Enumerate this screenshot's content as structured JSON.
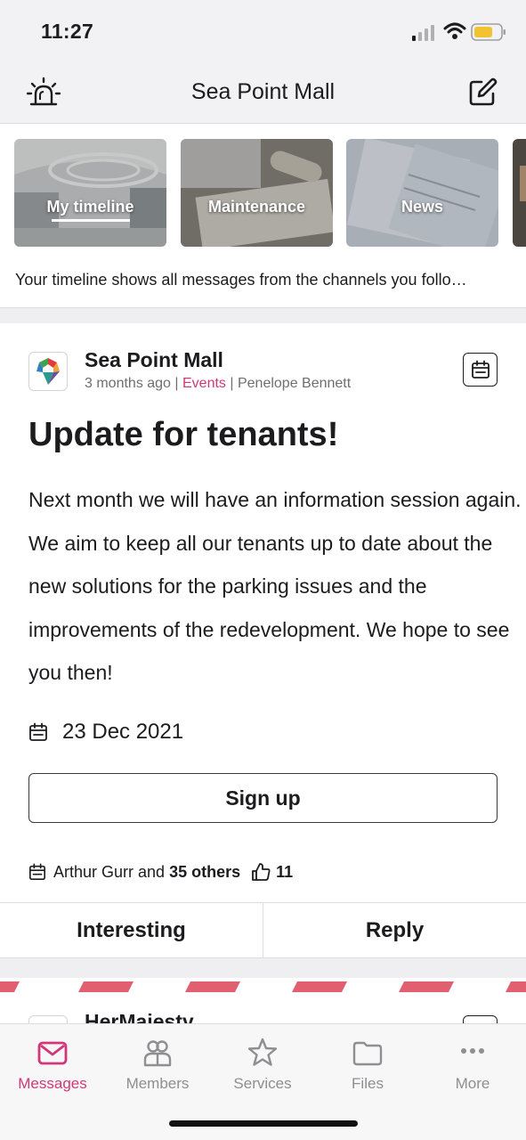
{
  "status_bar": {
    "time": "11:27"
  },
  "header": {
    "title": "Sea Point Mall"
  },
  "channels": {
    "cards": [
      {
        "label": "My timeline",
        "active": true
      },
      {
        "label": "Maintenance",
        "active": false
      },
      {
        "label": "News",
        "active": false
      }
    ],
    "description": "Your timeline shows all messages from the channels you follo…"
  },
  "post": {
    "author": "Sea Point Mall",
    "time_ago": "3 months ago",
    "separator": " | ",
    "channel": "Events",
    "poster": "Penelope Bennett",
    "title": "Update for tenants!",
    "body": "Next month we will have an information session again. We aim to keep all our tenants up to date about the new solutions for the parking issues and the improvements of the redevelopment. We hope to see you then!",
    "event_date": "23 Dec 2021",
    "signup_label": "Sign up",
    "attendees_name": "Arthur Gurr",
    "attendees_and": " and ",
    "attendees_others": "35 others",
    "likes": "11",
    "action_interesting": "Interesting",
    "action_reply": "Reply"
  },
  "next_post": {
    "author": "HerMajesty"
  },
  "tab_bar": {
    "tabs": [
      {
        "label": "Messages",
        "icon": "envelope-icon",
        "active": true
      },
      {
        "label": "Members",
        "icon": "members-icon",
        "active": false
      },
      {
        "label": "Services",
        "icon": "star-icon",
        "active": false
      },
      {
        "label": "Files",
        "icon": "folder-icon",
        "active": false
      },
      {
        "label": "More",
        "icon": "more-icon",
        "active": false
      }
    ]
  },
  "colors": {
    "accent": "#d1387a",
    "stripe": "#e06070",
    "text": "#1c1c1e",
    "muted": "#8e8e93"
  }
}
